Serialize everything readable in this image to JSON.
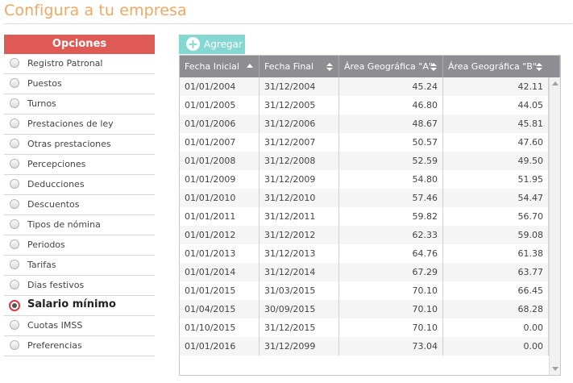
{
  "page": {
    "title": "Configura a tu empresa"
  },
  "sidebar": {
    "header": "Opciones",
    "items": [
      {
        "label": "Registro Patronal",
        "active": false
      },
      {
        "label": "Puestos",
        "active": false
      },
      {
        "label": "Turnos",
        "active": false
      },
      {
        "label": "Prestaciones de ley",
        "active": false
      },
      {
        "label": "Otras prestaciones",
        "active": false
      },
      {
        "label": "Percepciones",
        "active": false
      },
      {
        "label": "Deducciones",
        "active": false
      },
      {
        "label": "Descuentos",
        "active": false
      },
      {
        "label": "Tipos de nómina",
        "active": false
      },
      {
        "label": "Periodos",
        "active": false
      },
      {
        "label": "Tarifas",
        "active": false
      },
      {
        "label": "Dias festivos",
        "active": false
      },
      {
        "label": "Salario mínimo",
        "active": true
      },
      {
        "label": "Cuotas IMSS",
        "active": false
      },
      {
        "label": "Preferencias",
        "active": false
      }
    ]
  },
  "toolbar": {
    "add_label": "Agregar",
    "add_icon": "plus-circle-icon"
  },
  "grid": {
    "columns": [
      {
        "label": "Fecha Inicial",
        "sort": "asc"
      },
      {
        "label": "Fecha Final",
        "sort": "none"
      },
      {
        "label": "Área Geográfica \"A\"",
        "sort": "none"
      },
      {
        "label": "Área Geográfica \"B\"",
        "sort": "none"
      }
    ],
    "rows": [
      [
        "01/01/2004",
        "31/12/2004",
        "45.24",
        "42.11"
      ],
      [
        "01/01/2005",
        "31/12/2005",
        "46.80",
        "44.05"
      ],
      [
        "01/01/2006",
        "31/12/2006",
        "48.67",
        "45.81"
      ],
      [
        "01/01/2007",
        "31/12/2007",
        "50.57",
        "47.60"
      ],
      [
        "01/01/2008",
        "31/12/2008",
        "52.59",
        "49.50"
      ],
      [
        "01/01/2009",
        "31/12/2009",
        "54.80",
        "51.95"
      ],
      [
        "01/01/2010",
        "31/12/2010",
        "57.46",
        "54.47"
      ],
      [
        "01/01/2011",
        "31/12/2011",
        "59.82",
        "56.70"
      ],
      [
        "01/01/2012",
        "31/12/2012",
        "62.33",
        "59.08"
      ],
      [
        "01/01/2013",
        "31/12/2013",
        "64.76",
        "61.38"
      ],
      [
        "01/01/2014",
        "31/12/2014",
        "67.29",
        "63.77"
      ],
      [
        "01/01/2015",
        "31/03/2015",
        "70.10",
        "66.45"
      ],
      [
        "01/04/2015",
        "30/09/2015",
        "70.10",
        "68.28"
      ],
      [
        "01/10/2015",
        "31/12/2015",
        "70.10",
        "0.00"
      ],
      [
        "01/01/2016",
        "31/12/2099",
        "73.04",
        "0.00"
      ]
    ]
  },
  "colors": {
    "title": "#f0a860",
    "sidebar_header": "#e05a55",
    "add_button": "#85d8d2",
    "grid_header": "#8e8d92",
    "active_radio": "#d9383a"
  }
}
